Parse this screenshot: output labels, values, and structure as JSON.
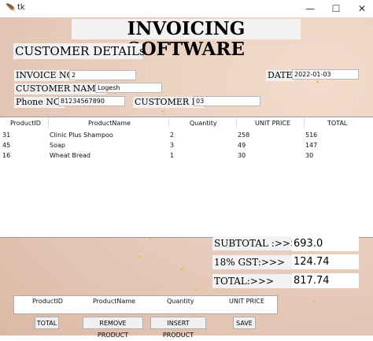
{
  "window": {
    "title": "tk",
    "minimize": "—",
    "maximize": "☐",
    "close": "✕"
  },
  "header": {
    "title": "INVOICING SOFTWARE",
    "section": "CUSTOMER DETAILs"
  },
  "form": {
    "invoice_label": "INVOICE NO",
    "invoice_value": "2",
    "date_label": "DATE",
    "date_value": "2022-01-03",
    "customer_name_label": "CUSTOMER NAME:",
    "customer_name_value": "Logesh",
    "phone_label": "Phone NO.",
    "phone_value": "81234567890",
    "customer_id_label": "CUSTOMER ID",
    "customer_id_value": "03"
  },
  "table": {
    "headers": [
      "ProductID",
      "ProductName",
      "Quantity",
      "UNIT PRICE",
      "TOTAL"
    ],
    "rows": [
      [
        "31",
        "Clinic Plus Shampoo",
        "2",
        "258",
        "516"
      ],
      [
        "45",
        "Soap",
        "3",
        "49",
        "147"
      ],
      [
        "16",
        "Wheat Bread",
        "1",
        "30",
        "30"
      ]
    ]
  },
  "totals": {
    "subtotal_label": "SUBTOTAL :>>>",
    "subtotal_value": "693.0",
    "gst_label": "18% GST:>>>",
    "gst_value": "124.74",
    "total_label": "TOTAL:>>>",
    "total_value": "817.74"
  },
  "entry_table": {
    "headers": [
      "ProductID",
      "ProductName",
      "Quantity",
      "UNIT PRICE"
    ]
  },
  "buttons": {
    "total": "TOTAL",
    "remove": "REMOVE PRODUCT",
    "insert": "INSERT PRODUCT",
    "save": "SAVE"
  }
}
